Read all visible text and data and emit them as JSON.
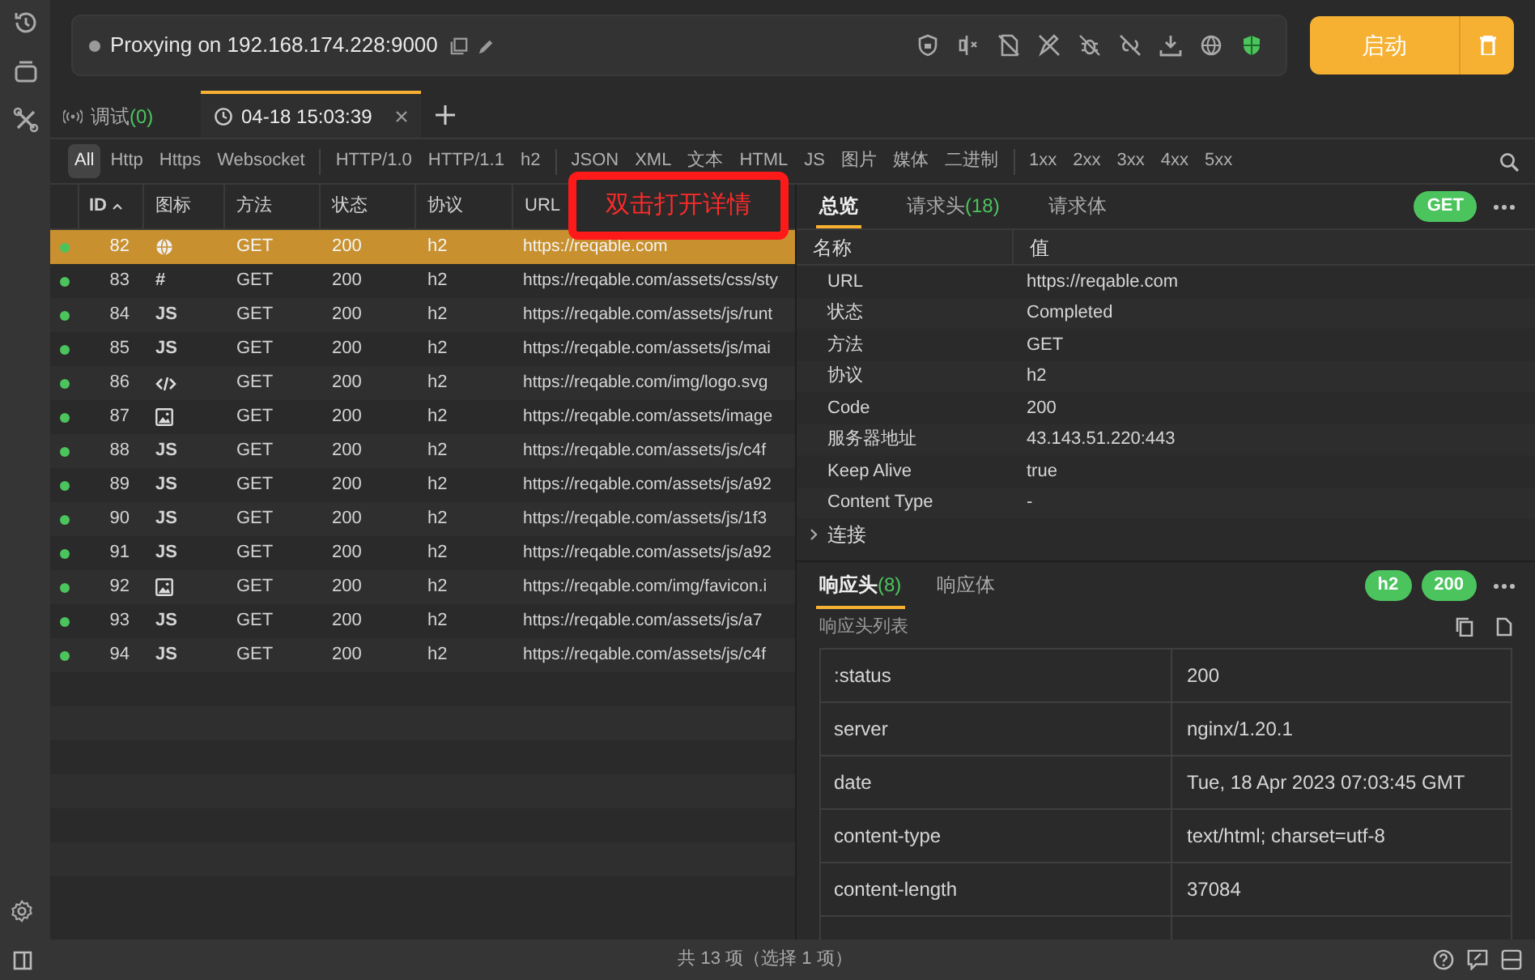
{
  "rail": {
    "items": [
      {
        "kind": "history"
      },
      {
        "kind": "layers"
      },
      {
        "kind": "tools"
      }
    ]
  },
  "proxy": {
    "text": "Proxying on 192.168.174.228:9000",
    "running": false
  },
  "start_button": {
    "label": "启动"
  },
  "tabs": [
    {
      "label": "调试",
      "count": "(0)",
      "kind": "debug",
      "selected": false
    },
    {
      "label": "04-18 15:03:39",
      "kind": "session",
      "selected": true
    }
  ],
  "filters": [
    [
      {
        "label": "All",
        "selected": true
      },
      {
        "label": "Http",
        "selected": false
      },
      {
        "label": "Https",
        "selected": false
      },
      {
        "label": "Websocket",
        "selected": false
      }
    ],
    [
      {
        "label": "HTTP/1.0",
        "selected": false
      },
      {
        "label": "HTTP/1.1",
        "selected": false
      },
      {
        "label": "h2",
        "selected": false
      }
    ],
    [
      {
        "label": "JSON",
        "selected": false
      },
      {
        "label": "XML",
        "selected": false
      },
      {
        "label": "文本",
        "selected": false
      },
      {
        "label": "HTML",
        "selected": false
      },
      {
        "label": "JS",
        "selected": false
      },
      {
        "label": "图片",
        "selected": false
      },
      {
        "label": "媒体",
        "selected": false
      },
      {
        "label": "二进制",
        "selected": false
      }
    ],
    [
      {
        "label": "1xx",
        "selected": false
      },
      {
        "label": "2xx",
        "selected": false
      },
      {
        "label": "3xx",
        "selected": false
      },
      {
        "label": "4xx",
        "selected": false
      },
      {
        "label": "5xx",
        "selected": false
      }
    ]
  ],
  "table": {
    "columns": [
      "ID",
      "图标",
      "方法",
      "状态",
      "协议",
      "URL"
    ],
    "rows": [
      {
        "id": "82",
        "icon": {
          "kind": "globe"
        },
        "method": "GET",
        "status": "200",
        "protocol": "h2",
        "url": "https://reqable.com",
        "selected": true
      },
      {
        "id": "83",
        "icon": {
          "kind": "text",
          "text": "#"
        },
        "method": "GET",
        "status": "200",
        "protocol": "h2",
        "url": "https://reqable.com/assets/css/sty",
        "selected": false
      },
      {
        "id": "84",
        "icon": {
          "kind": "text",
          "text": "JS"
        },
        "method": "GET",
        "status": "200",
        "protocol": "h2",
        "url": "https://reqable.com/assets/js/runt",
        "selected": false
      },
      {
        "id": "85",
        "icon": {
          "kind": "text",
          "text": "JS"
        },
        "method": "GET",
        "status": "200",
        "protocol": "h2",
        "url": "https://reqable.com/assets/js/mai",
        "selected": false
      },
      {
        "id": "86",
        "icon": {
          "kind": "code"
        },
        "method": "GET",
        "status": "200",
        "protocol": "h2",
        "url": "https://reqable.com/img/logo.svg",
        "selected": false
      },
      {
        "id": "87",
        "icon": {
          "kind": "image"
        },
        "method": "GET",
        "status": "200",
        "protocol": "h2",
        "url": "https://reqable.com/assets/image",
        "selected": false
      },
      {
        "id": "88",
        "icon": {
          "kind": "text",
          "text": "JS"
        },
        "method": "GET",
        "status": "200",
        "protocol": "h2",
        "url": "https://reqable.com/assets/js/c4f",
        "selected": false
      },
      {
        "id": "89",
        "icon": {
          "kind": "text",
          "text": "JS"
        },
        "method": "GET",
        "status": "200",
        "protocol": "h2",
        "url": "https://reqable.com/assets/js/a92",
        "selected": false
      },
      {
        "id": "90",
        "icon": {
          "kind": "text",
          "text": "JS"
        },
        "method": "GET",
        "status": "200",
        "protocol": "h2",
        "url": "https://reqable.com/assets/js/1f3",
        "selected": false
      },
      {
        "id": "91",
        "icon": {
          "kind": "text",
          "text": "JS"
        },
        "method": "GET",
        "status": "200",
        "protocol": "h2",
        "url": "https://reqable.com/assets/js/a92",
        "selected": false
      },
      {
        "id": "92",
        "icon": {
          "kind": "image"
        },
        "method": "GET",
        "status": "200",
        "protocol": "h2",
        "url": "https://reqable.com/img/favicon.i",
        "selected": false
      },
      {
        "id": "93",
        "icon": {
          "kind": "text",
          "text": "JS"
        },
        "method": "GET",
        "status": "200",
        "protocol": "h2",
        "url": "https://reqable.com/assets/js/a7",
        "selected": false
      },
      {
        "id": "94",
        "icon": {
          "kind": "text",
          "text": "JS"
        },
        "method": "GET",
        "status": "200",
        "protocol": "h2",
        "url": "https://reqable.com/assets/js/c4f",
        "selected": false
      }
    ]
  },
  "hint": "双击打开详情",
  "detail": {
    "tabs": [
      {
        "label": "总览",
        "selected": true
      },
      {
        "label": "请求头",
        "count": "(18)",
        "selected": false
      },
      {
        "label": "请求体",
        "selected": false
      }
    ],
    "method_badge": "GET",
    "columns": [
      "名称",
      "值"
    ],
    "rows": [
      {
        "name": "URL",
        "value": "https://reqable.com"
      },
      {
        "name": "状态",
        "value": "Completed"
      },
      {
        "name": "方法",
        "value": "GET"
      },
      {
        "name": "协议",
        "value": "h2"
      },
      {
        "name": "Code",
        "value": "200"
      },
      {
        "name": "服务器地址",
        "value": "43.143.51.220:443"
      },
      {
        "name": "Keep Alive",
        "value": "true"
      },
      {
        "name": "Content Type",
        "value": "-"
      }
    ],
    "groups": [
      {
        "name": "连接",
        "expanded": false
      }
    ]
  },
  "response": {
    "tabs": [
      {
        "label": "响应头",
        "count": "(8)",
        "selected": true
      },
      {
        "label": "响应体",
        "selected": false
      }
    ],
    "badges": [
      "h2",
      "200"
    ],
    "list_title": "响应头列表",
    "headers": [
      {
        "name": ":status",
        "value": "200"
      },
      {
        "name": "server",
        "value": "nginx/1.20.1"
      },
      {
        "name": "date",
        "value": "Tue, 18 Apr 2023 07:03:45 GMT"
      },
      {
        "name": "content-type",
        "value": "text/html; charset=utf-8"
      },
      {
        "name": "content-length",
        "value": "37084"
      }
    ]
  },
  "status_bar": {
    "text": "共 13 项（选择 1 项）"
  }
}
